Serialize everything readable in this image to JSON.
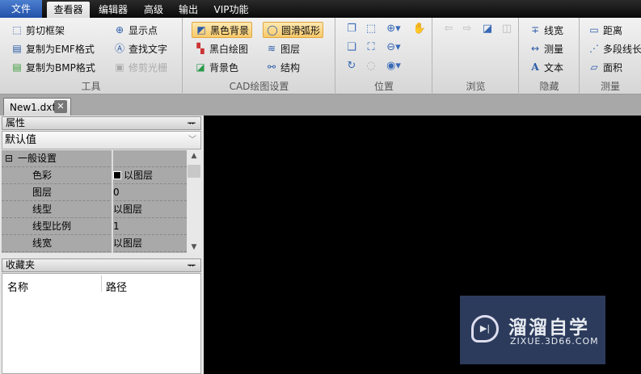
{
  "menu": {
    "tabs": [
      "文件",
      "查看器",
      "编辑器",
      "高级",
      "输出",
      "VIP功能"
    ],
    "active": "查看器"
  },
  "ribbon": {
    "tools": {
      "label": "工具",
      "items": [
        "剪切框架",
        "复制为EMF格式",
        "复制为BMP格式",
        "显示点",
        "查找文字",
        "修剪光栅"
      ]
    },
    "cad": {
      "label": "CAD绘图设置",
      "items": [
        "黑色背景",
        "黑白绘图",
        "背景色",
        "圆滑弧形",
        "图层",
        "结构"
      ]
    },
    "position": {
      "label": "位置"
    },
    "browse": {
      "label": "浏览"
    },
    "hide": {
      "label": "隐藏",
      "items": [
        "线宽",
        "测量",
        "文本"
      ]
    },
    "measure": {
      "label": "测量",
      "items": [
        "距离",
        "多段线长",
        "面积"
      ]
    }
  },
  "document_tab": {
    "name": "New1.dxf"
  },
  "properties": {
    "title": "属性",
    "dropdown": "默认值",
    "section": "一般设置",
    "rows": [
      {
        "k": "色彩",
        "v": "以图层"
      },
      {
        "k": "图层",
        "v": "0"
      },
      {
        "k": "线型",
        "v": "以图层"
      },
      {
        "k": "线型比例",
        "v": "1"
      },
      {
        "k": "线宽",
        "v": "以图层"
      }
    ]
  },
  "favorites": {
    "title": "收藏夹",
    "columns": [
      "名称",
      "路径"
    ]
  },
  "watermark": {
    "title": "溜溜自学",
    "url": "ZIXUE.3D66.COM"
  }
}
